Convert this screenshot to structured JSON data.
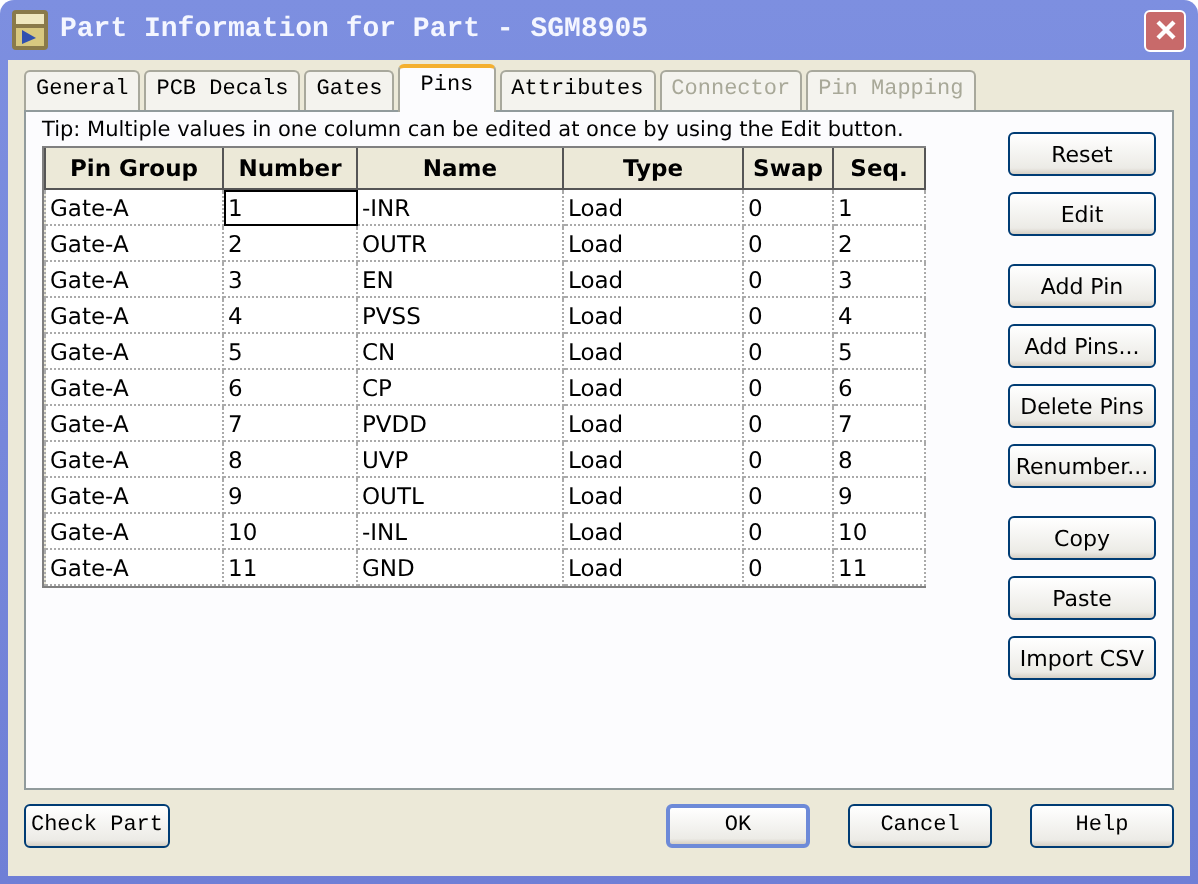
{
  "window": {
    "title": "Part Information for Part - SGM8905"
  },
  "tabs": [
    {
      "label": "General",
      "selected": false,
      "disabled": false
    },
    {
      "label": "PCB Decals",
      "selected": false,
      "disabled": false
    },
    {
      "label": "Gates",
      "selected": false,
      "disabled": false
    },
    {
      "label": "Pins",
      "selected": true,
      "disabled": false
    },
    {
      "label": "Attributes",
      "selected": false,
      "disabled": false
    },
    {
      "label": "Connector",
      "selected": false,
      "disabled": true
    },
    {
      "label": "Pin Mapping",
      "selected": false,
      "disabled": true
    }
  ],
  "tip": "Tip: Multiple values in one column can be edited at once by using the Edit button.",
  "table": {
    "columns": [
      "Pin Group",
      "Number",
      "Name",
      "Type",
      "Swap",
      "Seq."
    ],
    "rows": [
      {
        "cells": [
          "Gate-A",
          "1",
          "-INR",
          "Load",
          "0",
          "1"
        ],
        "focused": true
      },
      {
        "cells": [
          "Gate-A",
          "2",
          "OUTR",
          "Load",
          "0",
          "2"
        ],
        "focused": false
      },
      {
        "cells": [
          "Gate-A",
          "3",
          "EN",
          "Load",
          "0",
          "3"
        ],
        "focused": false
      },
      {
        "cells": [
          "Gate-A",
          "4",
          "PVSS",
          "Load",
          "0",
          "4"
        ],
        "focused": false
      },
      {
        "cells": [
          "Gate-A",
          "5",
          "CN",
          "Load",
          "0",
          "5"
        ],
        "focused": false
      },
      {
        "cells": [
          "Gate-A",
          "6",
          "CP",
          "Load",
          "0",
          "6"
        ],
        "focused": false
      },
      {
        "cells": [
          "Gate-A",
          "7",
          "PVDD",
          "Load",
          "0",
          "7"
        ],
        "focused": false
      },
      {
        "cells": [
          "Gate-A",
          "8",
          "UVP",
          "Load",
          "0",
          "8"
        ],
        "focused": false
      },
      {
        "cells": [
          "Gate-A",
          "9",
          "OUTL",
          "Load",
          "0",
          "9"
        ],
        "focused": false
      },
      {
        "cells": [
          "Gate-A",
          "10",
          "-INL",
          "Load",
          "0",
          "10"
        ],
        "focused": false
      },
      {
        "cells": [
          "Gate-A",
          "11",
          "GND",
          "Load",
          "0",
          "11"
        ],
        "focused": false
      }
    ]
  },
  "side_buttons": [
    [
      {
        "label": "Reset"
      },
      {
        "label": "Edit"
      }
    ],
    [
      {
        "label": "Add Pin"
      },
      {
        "label": "Add Pins..."
      },
      {
        "label": "Delete Pins"
      },
      {
        "label": "Renumber..."
      }
    ],
    [
      {
        "label": "Copy"
      },
      {
        "label": "Paste"
      },
      {
        "label": "Import CSV"
      }
    ]
  ],
  "footer": {
    "check_button": "Check Part",
    "buttons": [
      {
        "label": "OK",
        "default": true
      },
      {
        "label": "Cancel",
        "default": false
      },
      {
        "label": "Help",
        "default": false
      }
    ]
  }
}
